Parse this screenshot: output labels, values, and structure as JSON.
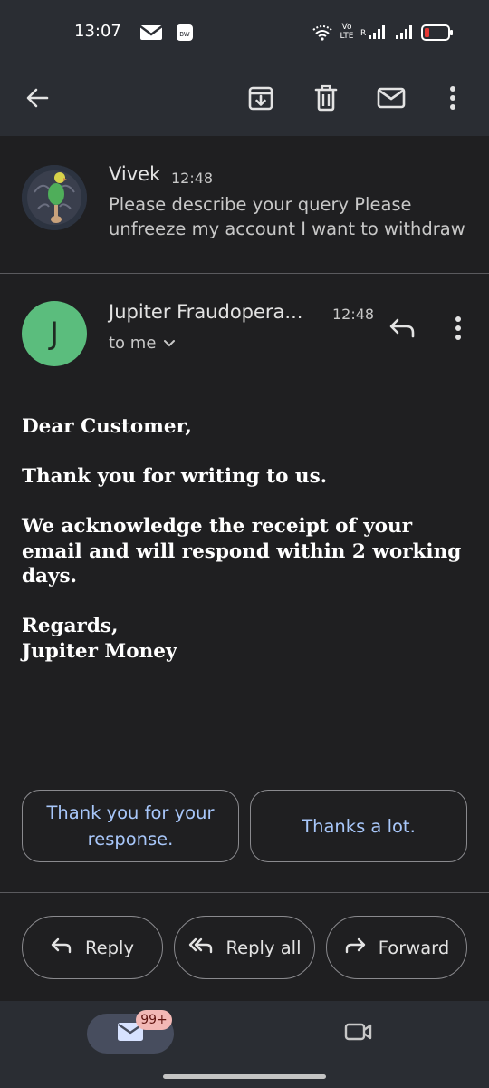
{
  "status_bar": {
    "time": "13:07",
    "network_label": "Vo LTE",
    "signal_label": "R",
    "icons": [
      "gmail-notification-icon",
      "app-notification-icon",
      "wifi-icon",
      "volte-icon",
      "signal-icon",
      "signal-icon",
      "battery-low-icon"
    ]
  },
  "app_bar": {
    "icons": [
      "back-arrow-icon",
      "archive-icon",
      "delete-icon",
      "mark-unread-icon",
      "more-vert-icon"
    ]
  },
  "thread_summary": {
    "sender": "Vivek",
    "time": "12:48",
    "snippet": "Please describe your query Please unfreeze my account I want to withdraw"
  },
  "message": {
    "avatar_letter": "J",
    "avatar_color": "#5bbd7d",
    "sender": "Jupiter Fraudopera...",
    "time": "12:48",
    "recipient": "to me",
    "body": {
      "greeting": "Dear Customer,",
      "line1": "Thank you for writing to us.",
      "line2": "We acknowledge the receipt of your email and will respond within 2 working days.",
      "signoff": "Regards,",
      "signature": "Jupiter Money"
    }
  },
  "smart_replies": [
    "Thank you for your response.",
    "Thanks a lot."
  ],
  "actions": {
    "reply": "Reply",
    "reply_all": "Reply all",
    "forward": "Forward"
  },
  "bottom_nav": {
    "mail_badge": "99+",
    "tabs": [
      "mail-icon",
      "video-camera-icon"
    ]
  },
  "colors": {
    "background": "#1f1f21",
    "bars": "#2a2d33",
    "smart_reply_text": "#a8c7fa",
    "badge": "#f2b8b5",
    "battery": "#e53935"
  }
}
